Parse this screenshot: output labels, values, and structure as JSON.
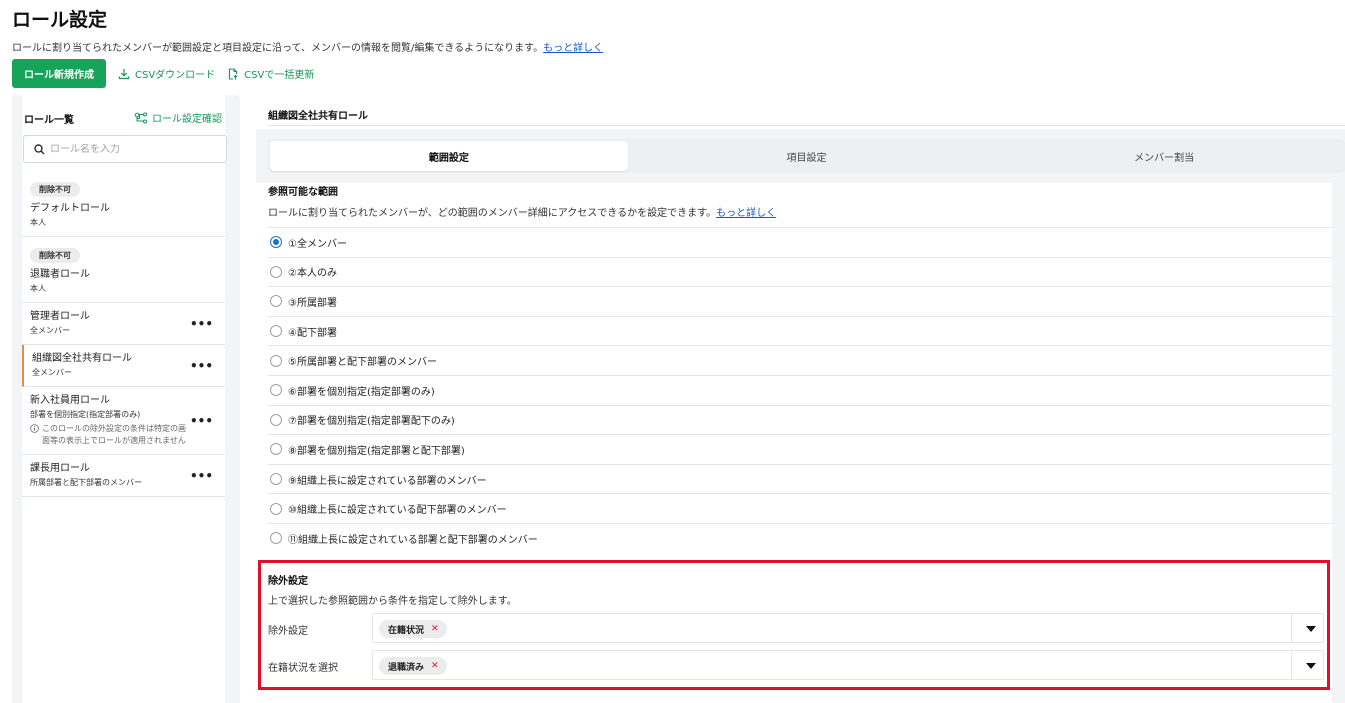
{
  "header": {
    "title": "ロール設定",
    "description": "ロールに割り当てられたメンバーが範囲設定と項目設定に沿って、メンバーの情報を閲覧/編集できるようになります。",
    "more_link": "もっと詳しく"
  },
  "toolbar": {
    "new_role": "ロール新規作成",
    "csv_download": "CSVダウンロード",
    "csv_update": "CSVで一括更新"
  },
  "sidebar": {
    "title": "ロール一覧",
    "confirm_link": "ロール設定確認",
    "search_placeholder": "ロール名を入力",
    "roles": [
      {
        "badge": "削除不可",
        "name": "デフォルトロール",
        "scope": "本人"
      },
      {
        "badge": "削除不可",
        "name": "退職者ロール",
        "scope": "本人"
      },
      {
        "name": "管理者ロール",
        "scope": "全メンバー"
      },
      {
        "name": "組織図全社共有ロール",
        "scope": "全メンバー"
      },
      {
        "name": "新入社員用ロール",
        "scope": "部署を個別指定(指定部署のみ)",
        "note": "このロールの除外設定の条件は特定の画面等の表示上でロールが適用されません"
      },
      {
        "name": "課長用ロール",
        "scope": "所属部署と配下部署のメンバー"
      }
    ]
  },
  "detail": {
    "title": "組織図全社共有ロール",
    "tabs": [
      "範囲設定",
      "項目設定",
      "メンバー割当"
    ],
    "scope_section": {
      "title": "参照可能な範囲",
      "description": "ロールに割り当てられたメンバーが、どの範囲のメンバー詳細にアクセスできるかを設定できます。",
      "more_link": "もっと詳しく",
      "options": [
        "①全メンバー",
        "②本人のみ",
        "③所属部署",
        "④配下部署",
        "⑤所属部署と配下部署のメンバー",
        "⑥部署を個別指定(指定部署のみ)",
        "⑦部署を個別指定(指定部署配下のみ)",
        "⑧部署を個別指定(指定部署と配下部署)",
        "⑨組織上長に設定されている部署のメンバー",
        "⑩組織上長に設定されている配下部署のメンバー",
        "⑪組織上長に設定されている部署と配下部署のメンバー"
      ],
      "selected": "①全メンバー"
    },
    "exclude_section": {
      "title": "除外設定",
      "description": "上で選択した参照範囲から条件を指定して除外します。",
      "rows": [
        {
          "label": "除外設定",
          "chip": "在籍状況"
        },
        {
          "label": "在籍状況を選択",
          "chip": "退職済み"
        }
      ]
    }
  },
  "colors": {
    "primary_green": "#17a35a",
    "link_blue": "#1a56c7",
    "highlight_red": "#e0102d",
    "active_accent": "#e9894a"
  }
}
